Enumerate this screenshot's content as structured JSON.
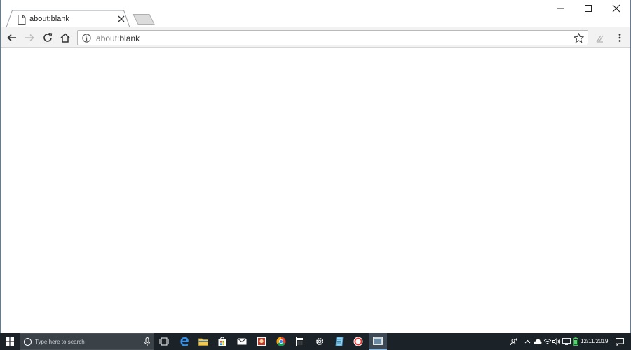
{
  "browser": {
    "tab": {
      "title": "about:blank",
      "icon": "page-icon"
    },
    "new_tab_icon": "new-tab-icon",
    "window_controls": [
      "minimize-icon",
      "maximize-icon",
      "close-icon"
    ],
    "toolbar": {
      "back_icon": "arrow-left-icon",
      "forward_icon": "arrow-right-icon",
      "reload_icon": "reload-icon",
      "home_icon": "home-icon",
      "omnibox": {
        "scheme": "about:",
        "rest": "blank",
        "info_icon": "info-icon",
        "star_icon": "star-icon"
      },
      "extension_icon": "extension-icon",
      "menu_icon": "kebab-menu-icon"
    },
    "colors": {
      "tab_strip": "#ffffff",
      "toolbar": "#f2f2f2",
      "content": "#ffffff"
    }
  },
  "taskbar": {
    "search_placeholder": "Type here to search",
    "apps": [
      "task-view-icon",
      "edge-icon",
      "file-explorer-icon",
      "store-icon",
      "mail-icon",
      "photo-app-icon",
      "chrome-icon",
      "calculator-icon",
      "settings-icon",
      "notepad-icon",
      "opera-icon",
      "active-app-icon"
    ],
    "tray": {
      "date": "12/11/2019",
      "icons": [
        "people-icon",
        "chevron-up-icon",
        "cloud-icon",
        "network-icon",
        "volume-icon",
        "display-icon",
        "battery-icon",
        "notification-icon"
      ]
    },
    "colors": {
      "background": "#1b2329",
      "search": "#3a4147"
    }
  }
}
